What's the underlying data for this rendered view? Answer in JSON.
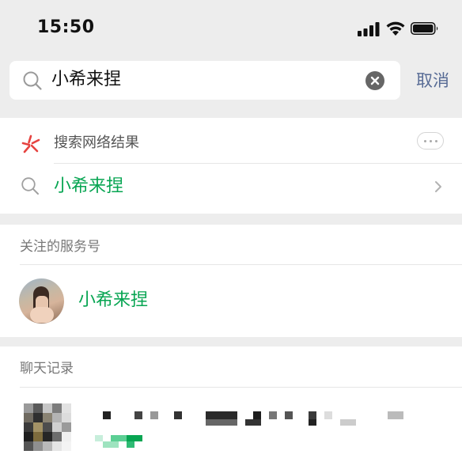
{
  "status_bar": {
    "time": "15:50"
  },
  "search": {
    "query": "小希来捏",
    "cancel_label": "取消"
  },
  "web_search": {
    "title": "搜索网络结果",
    "result_text": "小希来捏"
  },
  "official_accounts": {
    "title": "关注的服务号",
    "account_name": "小希来捏"
  },
  "chat_history": {
    "title": "聊天记录"
  },
  "colors": {
    "accent_green": "#07a552",
    "link_blue": "#576b95",
    "page_bg": "#ededed",
    "web_logo_red": "#e64340"
  }
}
